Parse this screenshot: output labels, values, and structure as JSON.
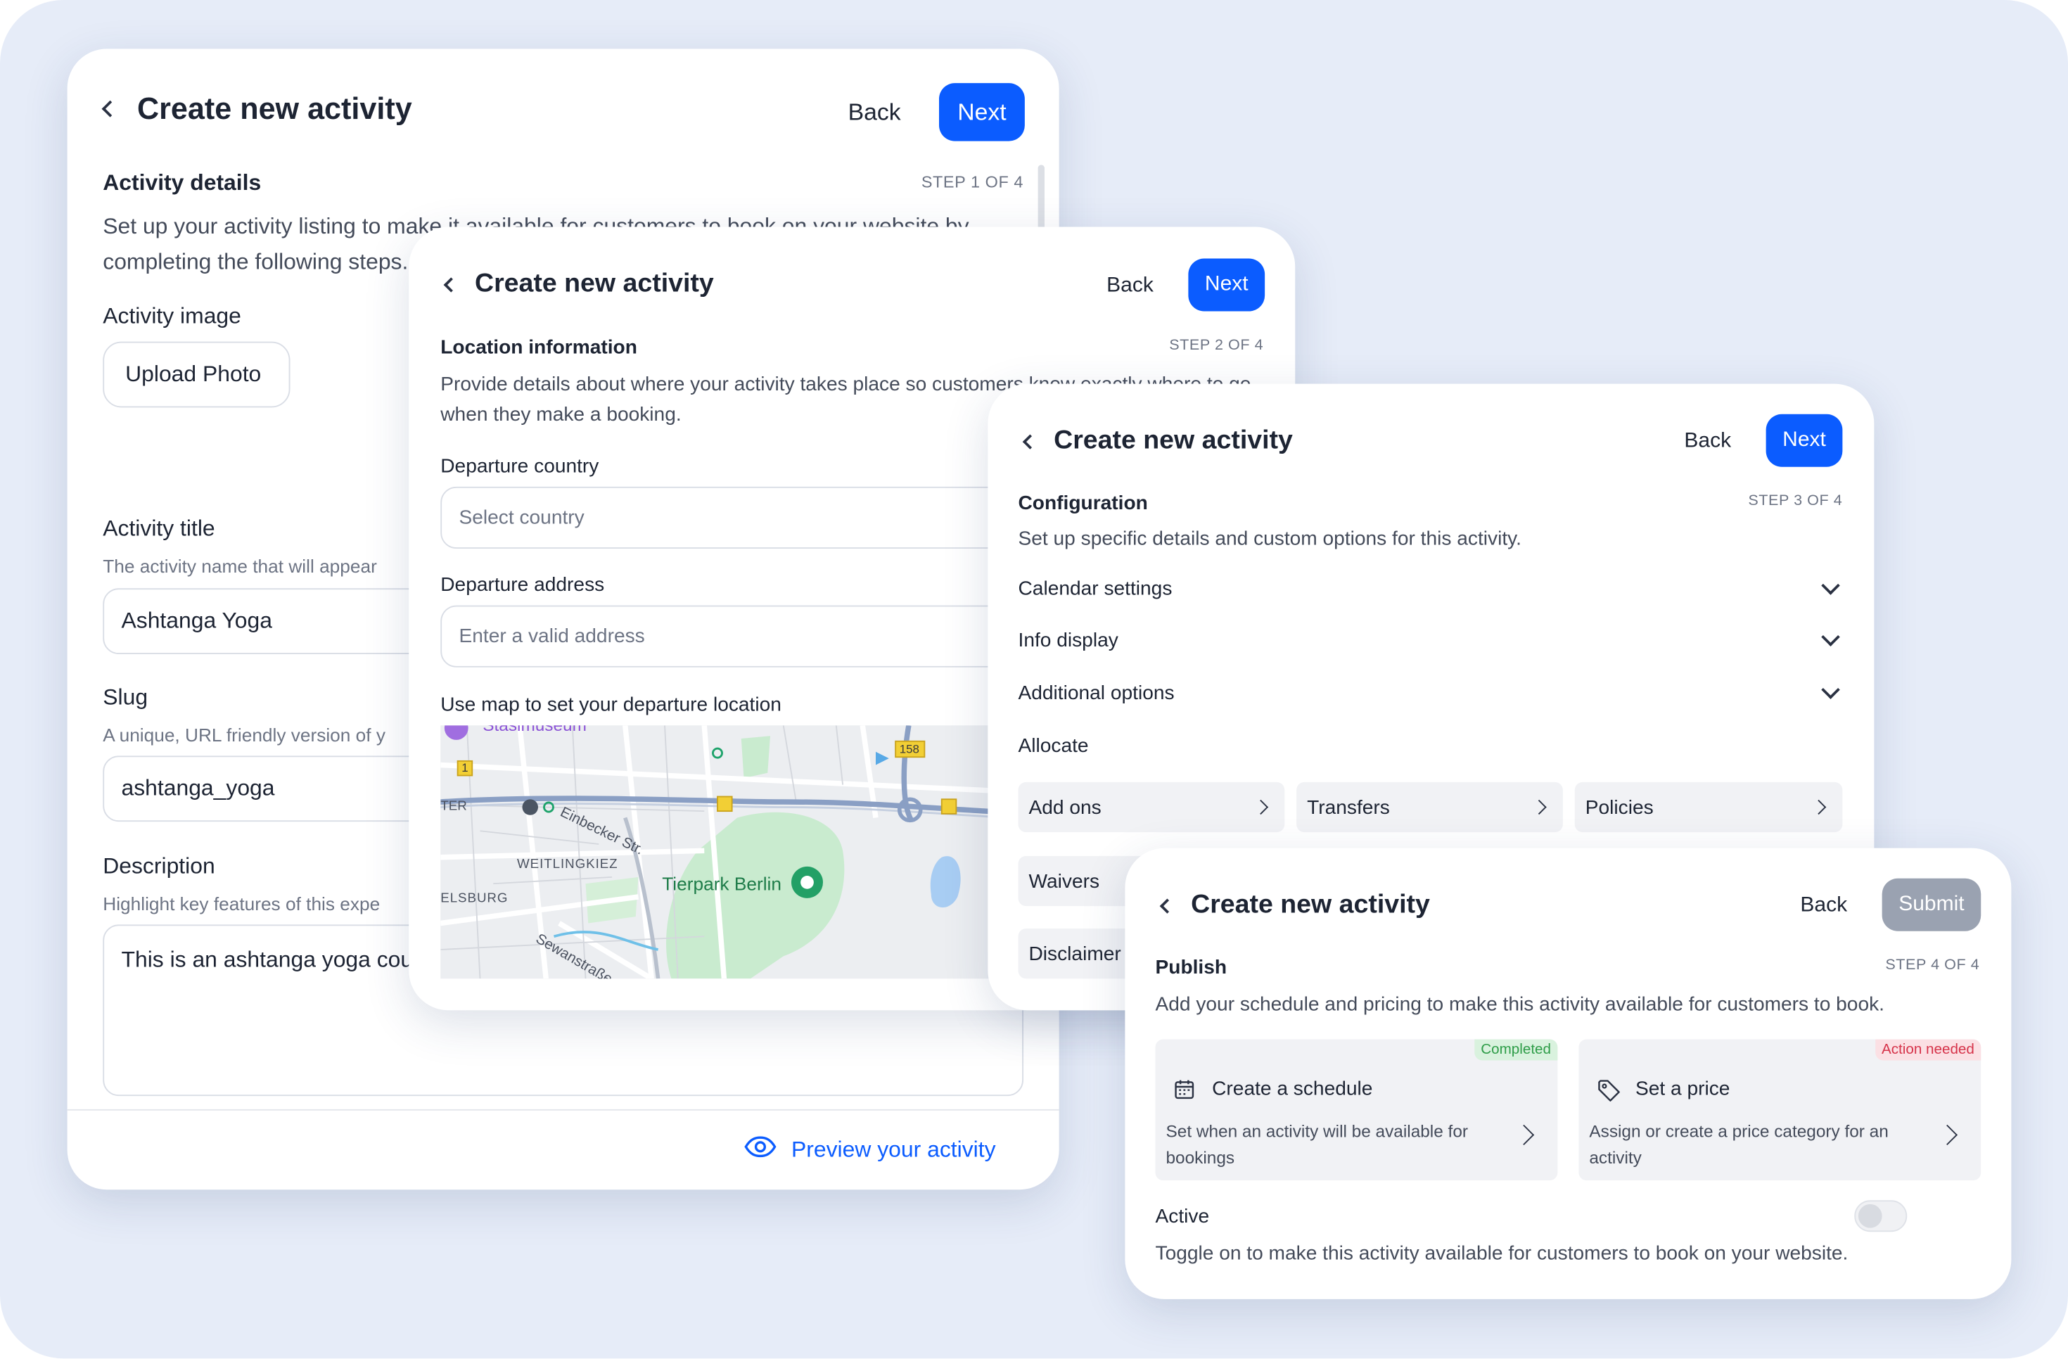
{
  "card1": {
    "title": "Create new activity",
    "back": "Back",
    "next": "Next",
    "section": "Activity details",
    "step": "STEP 1 OF 4",
    "description": "Set up your activity listing to make it available for customers to book on your website by completing the following steps.",
    "image_label": "Activity image",
    "upload": "Upload Photo",
    "title_label": "Activity title",
    "title_hint": "The activity name that will appear",
    "title_value": "Ashtanga Yoga",
    "slug_label": "Slug",
    "slug_hint": "A unique, URL friendly version of y",
    "slug_value": "ashtanga_yoga",
    "desc_label": "Description",
    "desc_hint": "Highlight key features of this expe",
    "desc_value": "This is an ashtanga yoga cou",
    "preview": "Preview your activity"
  },
  "card2": {
    "title": "Create new activity",
    "back": "Back",
    "next": "Next",
    "section": "Location information",
    "step": "STEP 2 OF 4",
    "description": "Provide details about where your activity takes place so customers know exactly where to go when they make a booking.",
    "country_label": "Departure country",
    "country_placeholder": "Select country",
    "address_label": "Departure address",
    "address_placeholder": "Enter a valid address",
    "map_label": "Use map to set your departure location",
    "map": {
      "poi_top": "Stasimuseum",
      "street_1": "Einbecker Str.",
      "district": "WEITLINGKIEZ",
      "district_2": "ELSBURG",
      "street_2": "Sewanstraße",
      "edge_label": "TER",
      "park": "Tierpark Berlin",
      "shield_1": "1",
      "shield_158": "158"
    }
  },
  "card3": {
    "title": "Create new activity",
    "back": "Back",
    "next": "Next",
    "section": "Configuration",
    "step": "STEP 3 OF 4",
    "description": "Set up specific details and custom options for this activity.",
    "rows": [
      "Calendar settings",
      "Info display",
      "Additional options"
    ],
    "allocate": "Allocate",
    "tiles": [
      "Add ons",
      "Transfers",
      "Policies"
    ],
    "tiles_2": [
      "Waivers",
      "Disclaimer"
    ]
  },
  "card4": {
    "title": "Create new activity",
    "back": "Back",
    "submit": "Submit",
    "section": "Publish",
    "step": "STEP 4 OF 4",
    "description": "Add your schedule and pricing to make this activity available for customers to book.",
    "schedule": {
      "badge": "Completed",
      "title": "Create a schedule",
      "text": "Set when an activity will be available for bookings"
    },
    "price": {
      "badge": "Action needed",
      "title": "Set a price",
      "text": "Assign or create a price category for an activity"
    },
    "active_label": "Active",
    "active_text": "Toggle on to make this activity available for customers to book on your website."
  },
  "colors": {
    "accent": "#0b5cff",
    "background": "#e6ecf8",
    "completed": "#2e9d48",
    "action_needed": "#d6334a"
  }
}
